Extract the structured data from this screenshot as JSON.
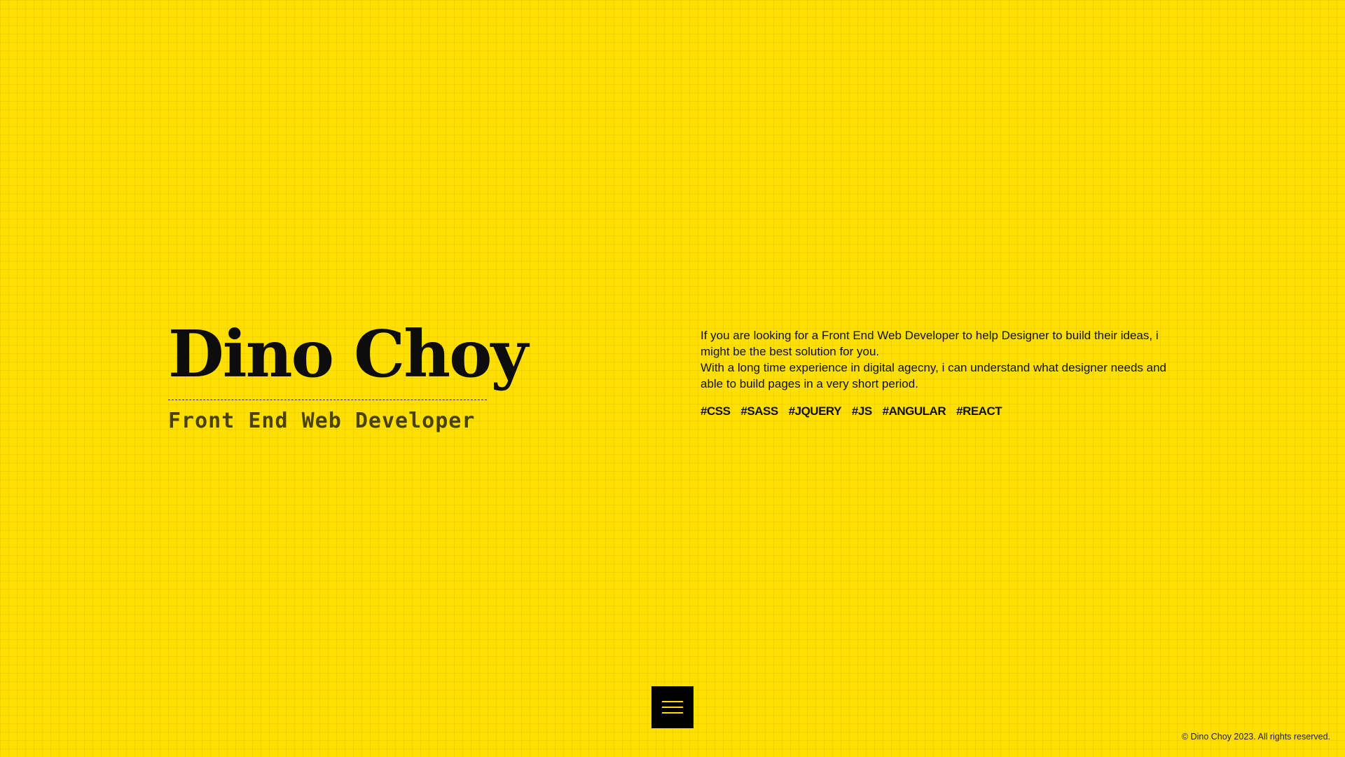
{
  "intro": {
    "name": "Dino Choy",
    "role": "Front End Web Developer"
  },
  "about": {
    "paragraph_1": "If you are looking for a Front End Web Developer to help Designer to build their ideas, i might be the best solution for you.",
    "paragraph_2": "With a long time experience in digital agecny, i can understand what designer needs and able to build pages in a very short period.",
    "tags": [
      "#CSS",
      "#SASS",
      "#JQUERY",
      "#JS",
      "#ANGULAR",
      "#REACT"
    ]
  },
  "menu": {
    "icon": "hamburger-menu-icon"
  },
  "footer": {
    "copyright": "© Dino Choy 2023. All rights reserved."
  },
  "colors": {
    "background": "#FFE000",
    "text": "#111111",
    "menu_button": "#000000"
  }
}
